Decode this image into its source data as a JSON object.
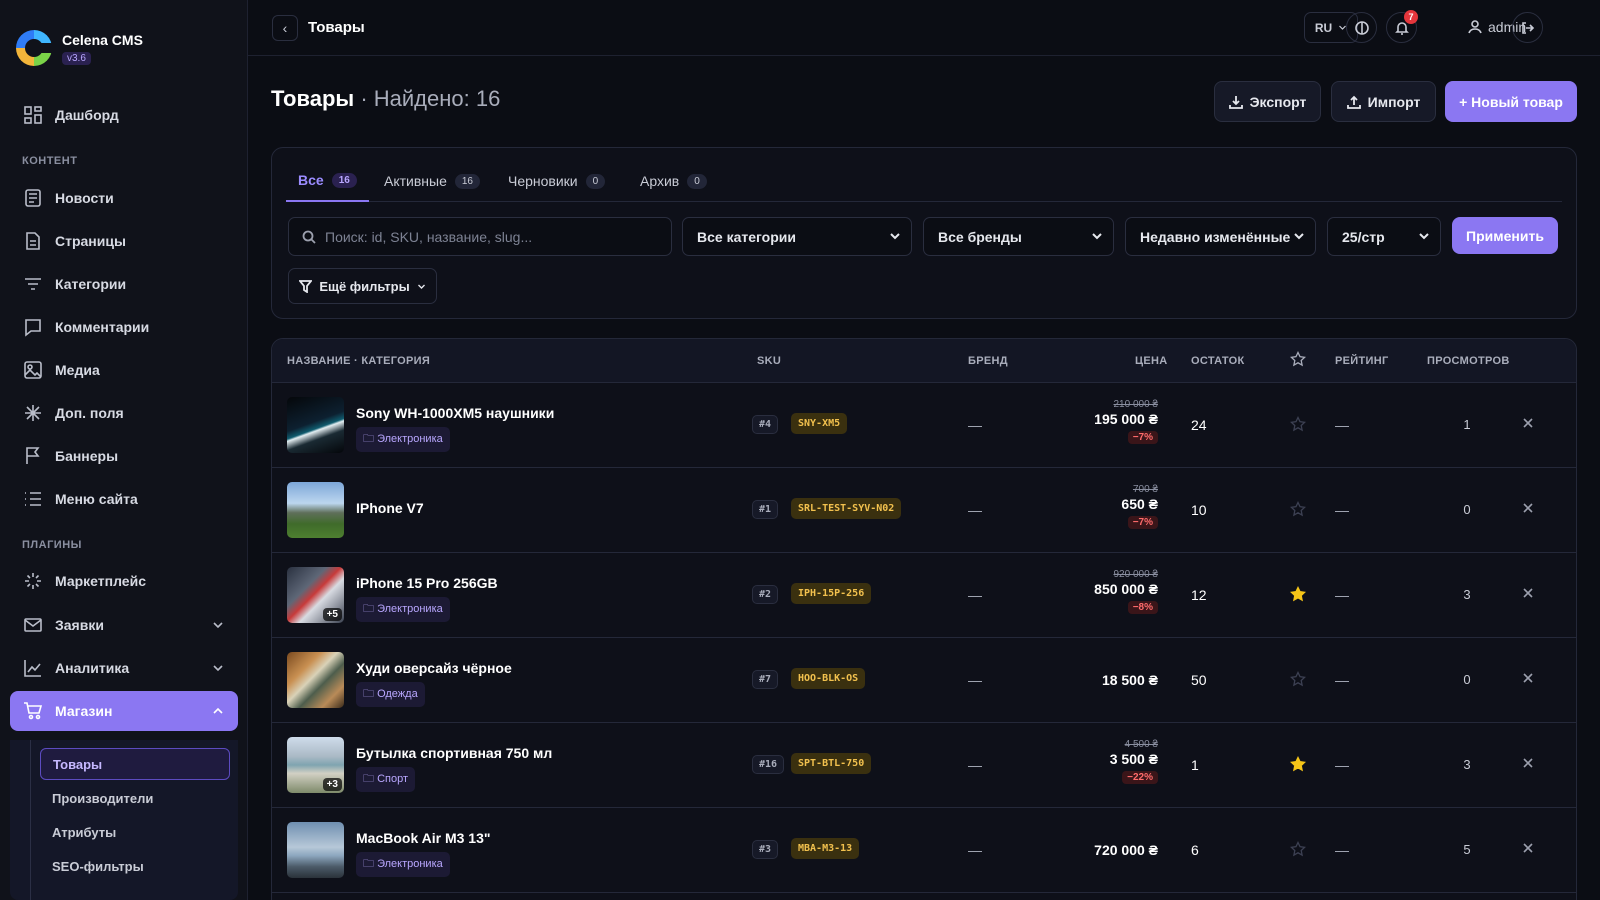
{
  "app": {
    "name": "Celena CMS",
    "version": "v3.6"
  },
  "sidebar": {
    "dashboard": "Дашборд",
    "section_content": "КОНТЕНТ",
    "content_items": [
      "Новости",
      "Страницы",
      "Категории",
      "Комментарии",
      "Медиа",
      "Доп. поля",
      "Баннеры",
      "Меню сайта"
    ],
    "section_plugins": "ПЛАГИНЫ",
    "plugin_items": [
      "Маркетплейс",
      "Заявки",
      "Аналитика",
      "Магазин"
    ],
    "shop_sub": [
      "Товары",
      "Производители",
      "Атрибуты",
      "SEO-фильтры"
    ]
  },
  "topbar": {
    "title": "Товары",
    "lang": "RU",
    "notifications": "7",
    "user": "admin"
  },
  "header": {
    "title": "Товары",
    "found": "· Найдено: 16",
    "export": "Экспорт",
    "import": "Импорт",
    "new": "+ Новый товар"
  },
  "filters": {
    "tabs": [
      {
        "label": "Все",
        "count": "16"
      },
      {
        "label": "Активные",
        "count": "16"
      },
      {
        "label": "Черновики",
        "count": "0"
      },
      {
        "label": "Архив",
        "count": "0"
      }
    ],
    "search_placeholder": "Поиск: id, SKU, название, slug...",
    "category": "Все категории",
    "brand": "Все бренды",
    "sort": "Недавно изменённые",
    "per_page": "25/стр",
    "apply": "Применить",
    "more": "Ещё фильтры"
  },
  "table": {
    "columns": [
      "НАЗВАНИЕ · КАТЕГОРИЯ",
      "SKU",
      "БРЕНД",
      "ЦЕНА",
      "ОСТАТОК",
      "РЕЙТИНГ",
      "ПРОСМОТРОВ"
    ],
    "rows": [
      {
        "name": "Sony WH-1000XM5 наушники",
        "category": "Электроника",
        "id": "#4",
        "sku": "SNY-XM5",
        "brand": "—",
        "old_price": "210 000 ₴",
        "price": "195 000 ₴",
        "discount": "−7%",
        "stock": "24",
        "featured": false,
        "rating": "—",
        "views": "1",
        "more": ""
      },
      {
        "name": "IPhone V7",
        "category": "",
        "id": "#1",
        "sku": "SRL-TEST-SYV-N02",
        "brand": "—",
        "old_price": "700 ₴",
        "price": "650 ₴",
        "discount": "−7%",
        "stock": "10",
        "featured": false,
        "rating": "—",
        "views": "0",
        "more": ""
      },
      {
        "name": "iPhone 15 Pro 256GB",
        "category": "Электроника",
        "id": "#2",
        "sku": "IPH-15P-256",
        "brand": "—",
        "old_price": "920 000 ₴",
        "price": "850 000 ₴",
        "discount": "−8%",
        "stock": "12",
        "featured": true,
        "rating": "—",
        "views": "3",
        "more": "+5"
      },
      {
        "name": "Худи оверсайз чёрное",
        "category": "Одежда",
        "id": "#7",
        "sku": "HOO-BLK-OS",
        "brand": "—",
        "old_price": "",
        "price": "18 500 ₴",
        "discount": "",
        "stock": "50",
        "featured": false,
        "rating": "—",
        "views": "0",
        "more": ""
      },
      {
        "name": "Бутылка спортивная 750 мл",
        "category": "Спорт",
        "id": "#16",
        "sku": "SPT-BTL-750",
        "brand": "—",
        "old_price": "4 500 ₴",
        "price": "3 500 ₴",
        "discount": "−22%",
        "stock": "1",
        "featured": true,
        "rating": "—",
        "views": "3",
        "more": "+3"
      },
      {
        "name": "MacBook Air M3 13\"",
        "category": "Электроника",
        "id": "#3",
        "sku": "MBA-M3-13",
        "brand": "—",
        "old_price": "",
        "price": "720 000 ₴",
        "discount": "",
        "stock": "6",
        "featured": false,
        "rating": "—",
        "views": "5",
        "more": ""
      }
    ]
  },
  "colors": {
    "accent": "#8b77f2",
    "background": "#0b0d14",
    "sku": "#f2c14e",
    "star": "#f5c518",
    "discount": "#ff6b6b"
  }
}
